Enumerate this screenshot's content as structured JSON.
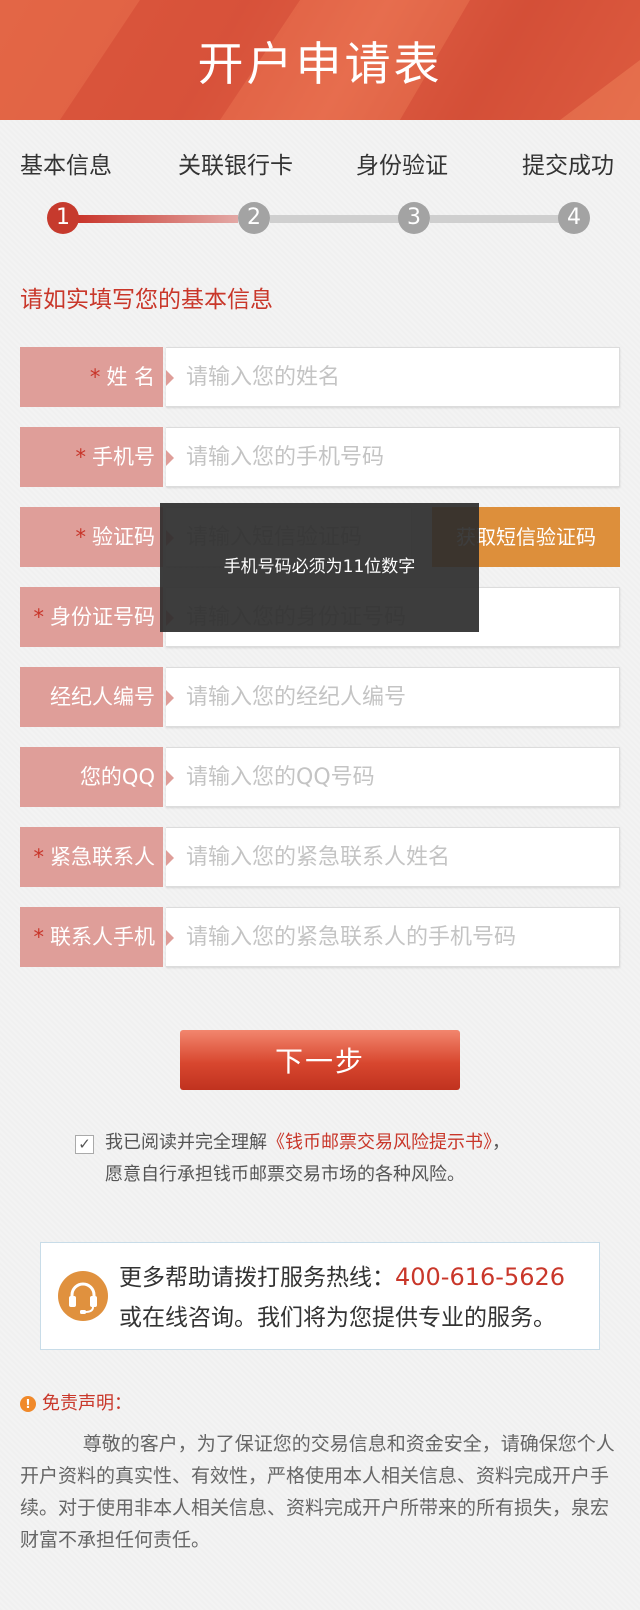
{
  "header": {
    "title": "开户申请表"
  },
  "steps": [
    {
      "label": "基本信息",
      "number": "1",
      "active": true
    },
    {
      "label": "关联银行卡",
      "number": "2",
      "active": false
    },
    {
      "label": "身份验证",
      "number": "3",
      "active": false
    },
    {
      "label": "提交成功",
      "number": "4",
      "active": false
    }
  ],
  "form": {
    "section_title": "请如实填写您的基本信息",
    "required_mark": "*",
    "fields": {
      "name": {
        "label": "姓 名",
        "placeholder": "请输入您的姓名",
        "required": true
      },
      "mobile": {
        "label": "手机号",
        "placeholder": "请输入您的手机号码",
        "required": true
      },
      "sms_code": {
        "label": "验证码",
        "placeholder": "请输入短信验证码",
        "required": true
      },
      "id_number": {
        "label": "身份证号码",
        "placeholder": "请输入您的身份证号码",
        "required": true
      },
      "broker_id": {
        "label": "经纪人编号",
        "placeholder": "请输入您的经纪人编号",
        "required": false
      },
      "qq": {
        "label": "您的QQ",
        "placeholder": "请输入您的QQ号码",
        "required": false
      },
      "emergency_contact": {
        "label": "紧急联系人",
        "placeholder": "请输入您的紧急联系人姓名",
        "required": true
      },
      "contact_mobile": {
        "label": "联系人手机",
        "placeholder": "请输入您的紧急联系人的手机号码",
        "required": true
      }
    },
    "sms_button_label": "获取短信验证码",
    "next_button_label": "下一步"
  },
  "toast": {
    "message": "手机号码必须为11位数字"
  },
  "agreement": {
    "checked": true,
    "check_glyph": "✓",
    "prefix": "我已阅读并完全理解",
    "link_text": "《钱币邮票交易风险提示书》",
    "suffix": "，",
    "line2": "愿意自行承担钱币邮票交易市场的各种风险。"
  },
  "help": {
    "prefix": "更多帮助请拨打服务热线：",
    "phone": "400-616-5626",
    "line2": "或在线咨询。我们将为您提供专业的服务。",
    "icon": "headset-icon"
  },
  "disclaimer": {
    "title": "免责声明：",
    "icon_glyph": "!",
    "body": "尊敬的客户，为了保证您的交易信息和资金安全，请确保您个人开户资料的真实性、有效性，严格使用本人相关信息、资料完成开户手续。对于使用非本人相关信息、资料完成开户所带来的所有损失，泉宏财富不承担任何责任。"
  },
  "colors": {
    "brand_red": "#c9372a",
    "header_red": "#dd5a3c",
    "label_pink": "#df9e99",
    "orange": "#dd8f3b",
    "inactive_gray": "#a3a3a3"
  }
}
